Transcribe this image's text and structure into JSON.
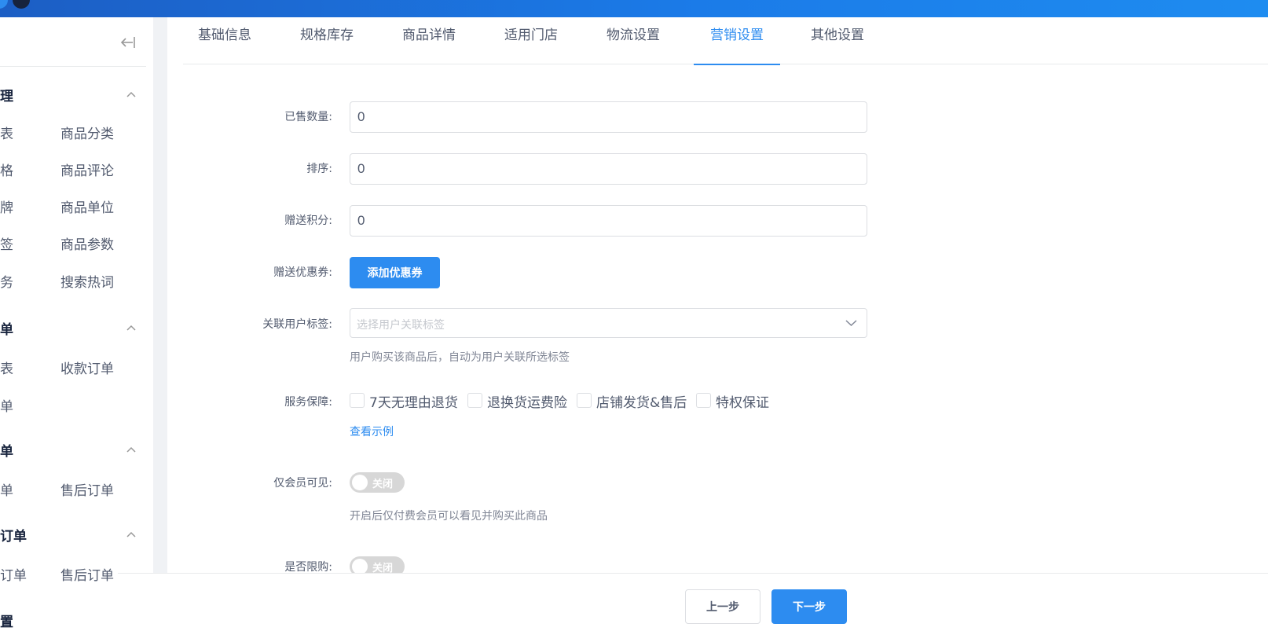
{
  "sidebar": {
    "groups": [
      {
        "title": "理",
        "items": [
          [
            "表",
            "商品分类"
          ],
          [
            "格",
            "商品评论"
          ],
          [
            "牌",
            "商品单位"
          ],
          [
            "签",
            "商品参数"
          ],
          [
            "务",
            "搜索热词"
          ]
        ]
      },
      {
        "title": "单",
        "items": [
          [
            "表",
            "收款订单"
          ],
          [
            "单",
            ""
          ]
        ]
      },
      {
        "title": "单",
        "items": [
          [
            "单",
            "售后订单"
          ]
        ]
      },
      {
        "title": "订单",
        "items": [
          [
            "订单",
            "售后订单"
          ]
        ]
      },
      {
        "title": "置",
        "items": []
      }
    ]
  },
  "tabs": [
    "基础信息",
    "规格库存",
    "商品详情",
    "适用门店",
    "物流设置",
    "营销设置",
    "其他设置"
  ],
  "active_tab_index": 5,
  "form": {
    "sold_label": "已售数量:",
    "sold_value": "0",
    "sort_label": "排序:",
    "sort_value": "0",
    "points_label": "赠送积分:",
    "points_value": "0",
    "coupon_label": "赠送优惠券:",
    "coupon_button": "添加优惠券",
    "tag_label": "关联用户标签:",
    "tag_placeholder": "选择用户关联标签",
    "tag_hint": "用户购买该商品后，自动为用户关联所选标签",
    "service_label": "服务保障:",
    "service_options": [
      "7天无理由退货",
      "退换货运费险",
      "店铺发货&售后",
      "特权保证"
    ],
    "service_link": "查看示例",
    "member_label": "仅会员可见:",
    "member_switch": "关闭",
    "member_hint": "开启后仅付费会员可以看见并购买此商品",
    "limit_label": "是否限购:",
    "limit_switch": "关闭"
  },
  "footer": {
    "prev": "上一步",
    "next": "下一步"
  },
  "colors": {
    "primary": "#2d8cf0",
    "topbar": "#1b7be8"
  }
}
